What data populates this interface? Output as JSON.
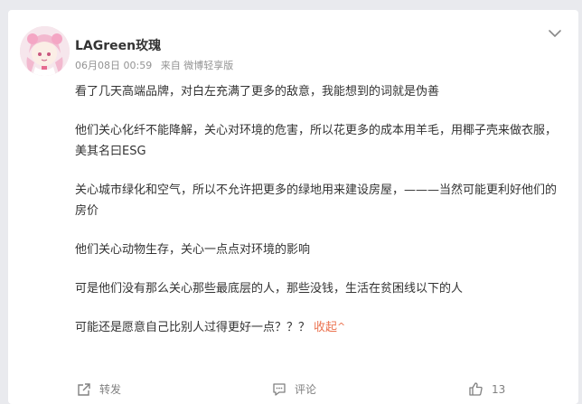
{
  "post": {
    "username": "LAGreen玫瑰",
    "date": "06月08日 00:59",
    "source": "来自 微博轻享版",
    "paragraphs": [
      "看了几天高端品牌，对白左充满了更多的敌意，我能想到的词就是伪善",
      "他们关心化纤不能降解，关心对环境的危害，所以花更多的成本用羊毛，用椰子壳来做衣服，美其名曰ESG",
      "关心城市绿化和空气，所以不允许把更多的绿地用来建设房屋，———当然可能更利好他们的房价",
      "他们关心动物生存，关心一点点对环境的影响",
      "可是他们没有那么关心那些最底层的人，那些没钱，生活在贫困线以下的人"
    ],
    "last_line": "可能还是愿意自己比别人过得更好一点？？？",
    "collapse_label": "收起",
    "collapse_chevron": "^"
  },
  "actions": {
    "repost_label": "转发",
    "comment_label": "评论",
    "like_count": "13"
  },
  "icons": {
    "more": "chevron-down-icon",
    "repost": "share-icon",
    "comment": "comment-icon",
    "like": "thumbs-up-icon"
  },
  "colors": {
    "accent": "#eb7350",
    "meta_text": "#939393",
    "body_text": "#333333"
  }
}
